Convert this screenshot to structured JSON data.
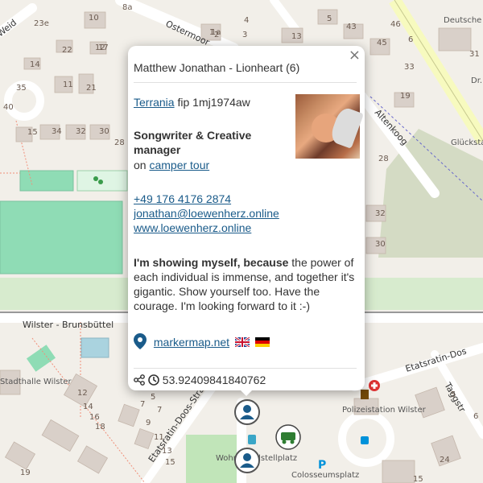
{
  "map": {
    "streets": {
      "ostermoor": "Ostermoor",
      "altenkoog": "Altenkoog",
      "weid": "Weid",
      "wilster_brunsbuttel": "Wilster - Brunsbüttel",
      "etatsratin_doos_strasse": "Etatsratin-Doos-Straße",
      "etatsratin_doos_2": "Etatsratin-Dos",
      "taggstr": "Taggstr"
    },
    "pois": {
      "telekom": "Deutsche Telekom AG",
      "glueckstadt_werkstatt": "Glückstad Werkstatt",
      "polizeistation": "Polizeistation Wilster",
      "colosseumsplatz": "Colosseumsplatz",
      "wohnmobilstellplatz": "Wohnmobilstellplatz",
      "stadthalle": "Stadthalle Wilster",
      "dr": "Dr."
    },
    "house_numbers": [
      "23e",
      "10",
      "12",
      "8a",
      "2",
      "1",
      "13",
      "5",
      "22",
      "14",
      "17",
      "11",
      "21",
      "15",
      "34",
      "32",
      "30",
      "28",
      "26",
      "19",
      "6",
      "33",
      "31",
      "35",
      "40",
      "32",
      "30",
      "28",
      "1a",
      "4",
      "3",
      "43",
      "45",
      "46",
      "12",
      "14",
      "16",
      "18",
      "7",
      "9",
      "11",
      "13",
      "15",
      "3",
      "5",
      "7",
      "5",
      "6",
      "19",
      "24",
      "15"
    ]
  },
  "popup": {
    "title": "Matthew Jonathan - Lionheart (6)",
    "close": "×",
    "vehicle_link": "Terrania",
    "vehicle_rest": " fip 1mj1974aw",
    "role": "Songwriter & Creative manager",
    "tour_prefix": "on ",
    "tour_link": "camper tour",
    "phone": "+49 176 4176 2874",
    "email": "jonathan@loewenherz.online",
    "website": "www.loewenherz.online",
    "statement_bold": "I'm showing myself, because",
    "statement_rest": " the power of each individual is immense, and together it's gigantic. Show yourself too. Have the courage. I'm looking forward to it :-)",
    "markermap_link": "markermap.net",
    "coord": "53.92409841840762"
  },
  "colors": {
    "accent": "#1a5b8a",
    "park": "#8fdcb5",
    "road_primary": "#f7fabf"
  }
}
